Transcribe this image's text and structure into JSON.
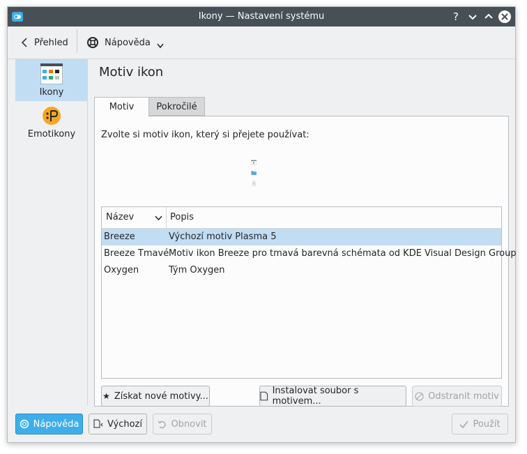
{
  "window": {
    "title": "Ikony  — Nastavení systému"
  },
  "toolbar": {
    "back_label": "Přehled",
    "help_label": "Nápověda"
  },
  "sidebar": {
    "items": [
      {
        "label": "Ikony"
      },
      {
        "label": "Emotikony"
      }
    ]
  },
  "page": {
    "title": "Motiv ikon"
  },
  "tabs": [
    {
      "label": "Motiv"
    },
    {
      "label": "Pokročilé"
    }
  ],
  "theme_panel": {
    "prompt": "Zvolte si motiv ikon, který si přejete používat:",
    "columns": [
      "Název",
      "Popis"
    ],
    "rows": [
      {
        "name": "Breeze",
        "description": "Výchozí motiv Plasma 5"
      },
      {
        "name": "Breeze Tmavé",
        "description": "Motiv ikon Breeze pro tmavá barevná schémata od KDE Visual Design Group"
      },
      {
        "name": "Oxygen",
        "description": "Tým Oxygen"
      }
    ],
    "buttons": {
      "get_new": "Získat nové motivy...",
      "install": "Instalovat soubor s motivem...",
      "remove": "Odstranit motiv"
    }
  },
  "footer": {
    "help": "Nápověda",
    "defaults": "Výchozí",
    "reset": "Obnovit",
    "apply": "Použít"
  },
  "colors": {
    "accent": "#3daee9",
    "selection": "#c1ddf3",
    "titlebar": "#475057"
  }
}
